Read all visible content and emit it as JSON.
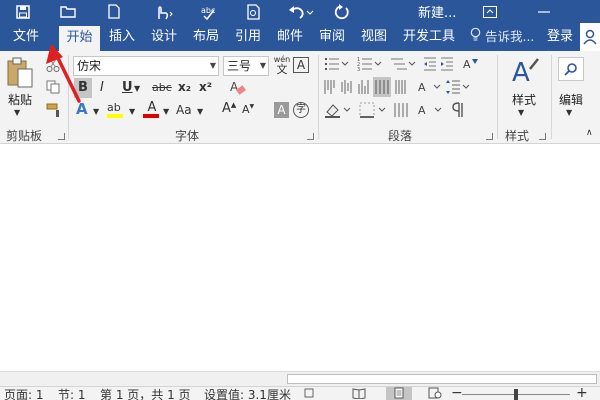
{
  "titlebar": {
    "title": "新建...",
    "icons": [
      "save-icon",
      "open-folder-icon",
      "new-doc-icon",
      "touch-mode-icon",
      "spell-check-icon",
      "print-preview-icon",
      "undo-icon",
      "redo-icon",
      "ribbon-options-icon",
      "minimize-icon"
    ]
  },
  "menu": {
    "tabs": [
      "文件",
      "开始",
      "插入",
      "设计",
      "布局",
      "引用",
      "邮件",
      "审阅",
      "视图",
      "开发工具"
    ],
    "active_tab": "开始",
    "tell_me": "告诉我...",
    "login": "登录"
  },
  "ribbon": {
    "clipboard": {
      "label": "剪贴板",
      "paste": "粘贴"
    },
    "font": {
      "label": "字体",
      "font_name": "仿宋",
      "font_size": "三号",
      "wen_glyph": "wén",
      "wen_char": "文",
      "bold": "B",
      "italic": "I",
      "underline": "U",
      "strike": "abc",
      "subscript": "x₂",
      "superscript": "x²",
      "grow": "A",
      "shrink": "A",
      "change_case": "Aa",
      "highlight": "ab",
      "font_color": "A",
      "char_border": "A",
      "char_shading": "A",
      "enclose": "字"
    },
    "paragraph": {
      "label": "段落"
    },
    "styles": {
      "label": "样式",
      "button": "样式"
    },
    "editing": {
      "button": "编辑"
    }
  },
  "statusbar": {
    "page": "页面: 1",
    "section": "节: 1",
    "page_of": "第 1 页，共 1 页",
    "setting": "设置值: 3.1厘米",
    "zoom_minus": "−",
    "zoom_plus": "+",
    "zoom_level_fraction": 0.5
  },
  "colors": {
    "brand_blue": "#2b579a",
    "ribbon_bg": "#f3f3f3",
    "highlight_yellow": "#ffff00",
    "font_red": "#e00000",
    "annotation_red": "#e02020"
  }
}
